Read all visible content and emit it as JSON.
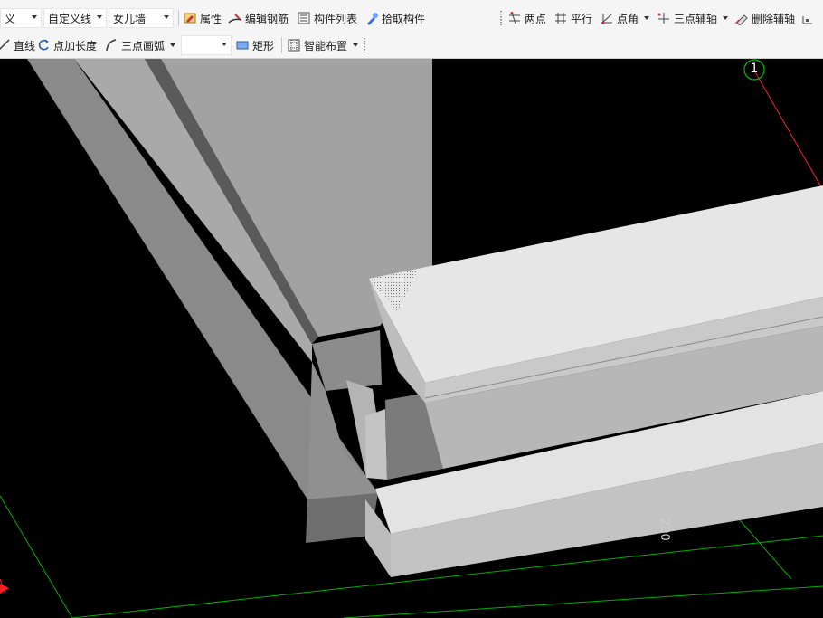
{
  "toolbar": {
    "row1": {
      "type_select": "义",
      "line_select": "自定义线",
      "component_select": "女儿墙",
      "properties": "属性",
      "edit_rebar": "编辑钢筋",
      "component_list": "构件列表",
      "pick_component": "拾取构件",
      "two_points": "两点",
      "parallel": "平行",
      "point_angle": "点角",
      "three_point_axis": "三点辅轴",
      "delete_axis": "删除辅轴"
    },
    "row2": {
      "line": "直线",
      "point_length": "点加长度",
      "three_point_arc": "三点画弧",
      "rectangle": "矩形",
      "smart_layout": "智能布置"
    }
  },
  "viewport": {
    "axis_label": "1",
    "dimension_label": "200",
    "colors": {
      "background": "#000000",
      "grid": "#00b000",
      "axis": "#ff2020",
      "axis_marker": "#00c000"
    }
  }
}
